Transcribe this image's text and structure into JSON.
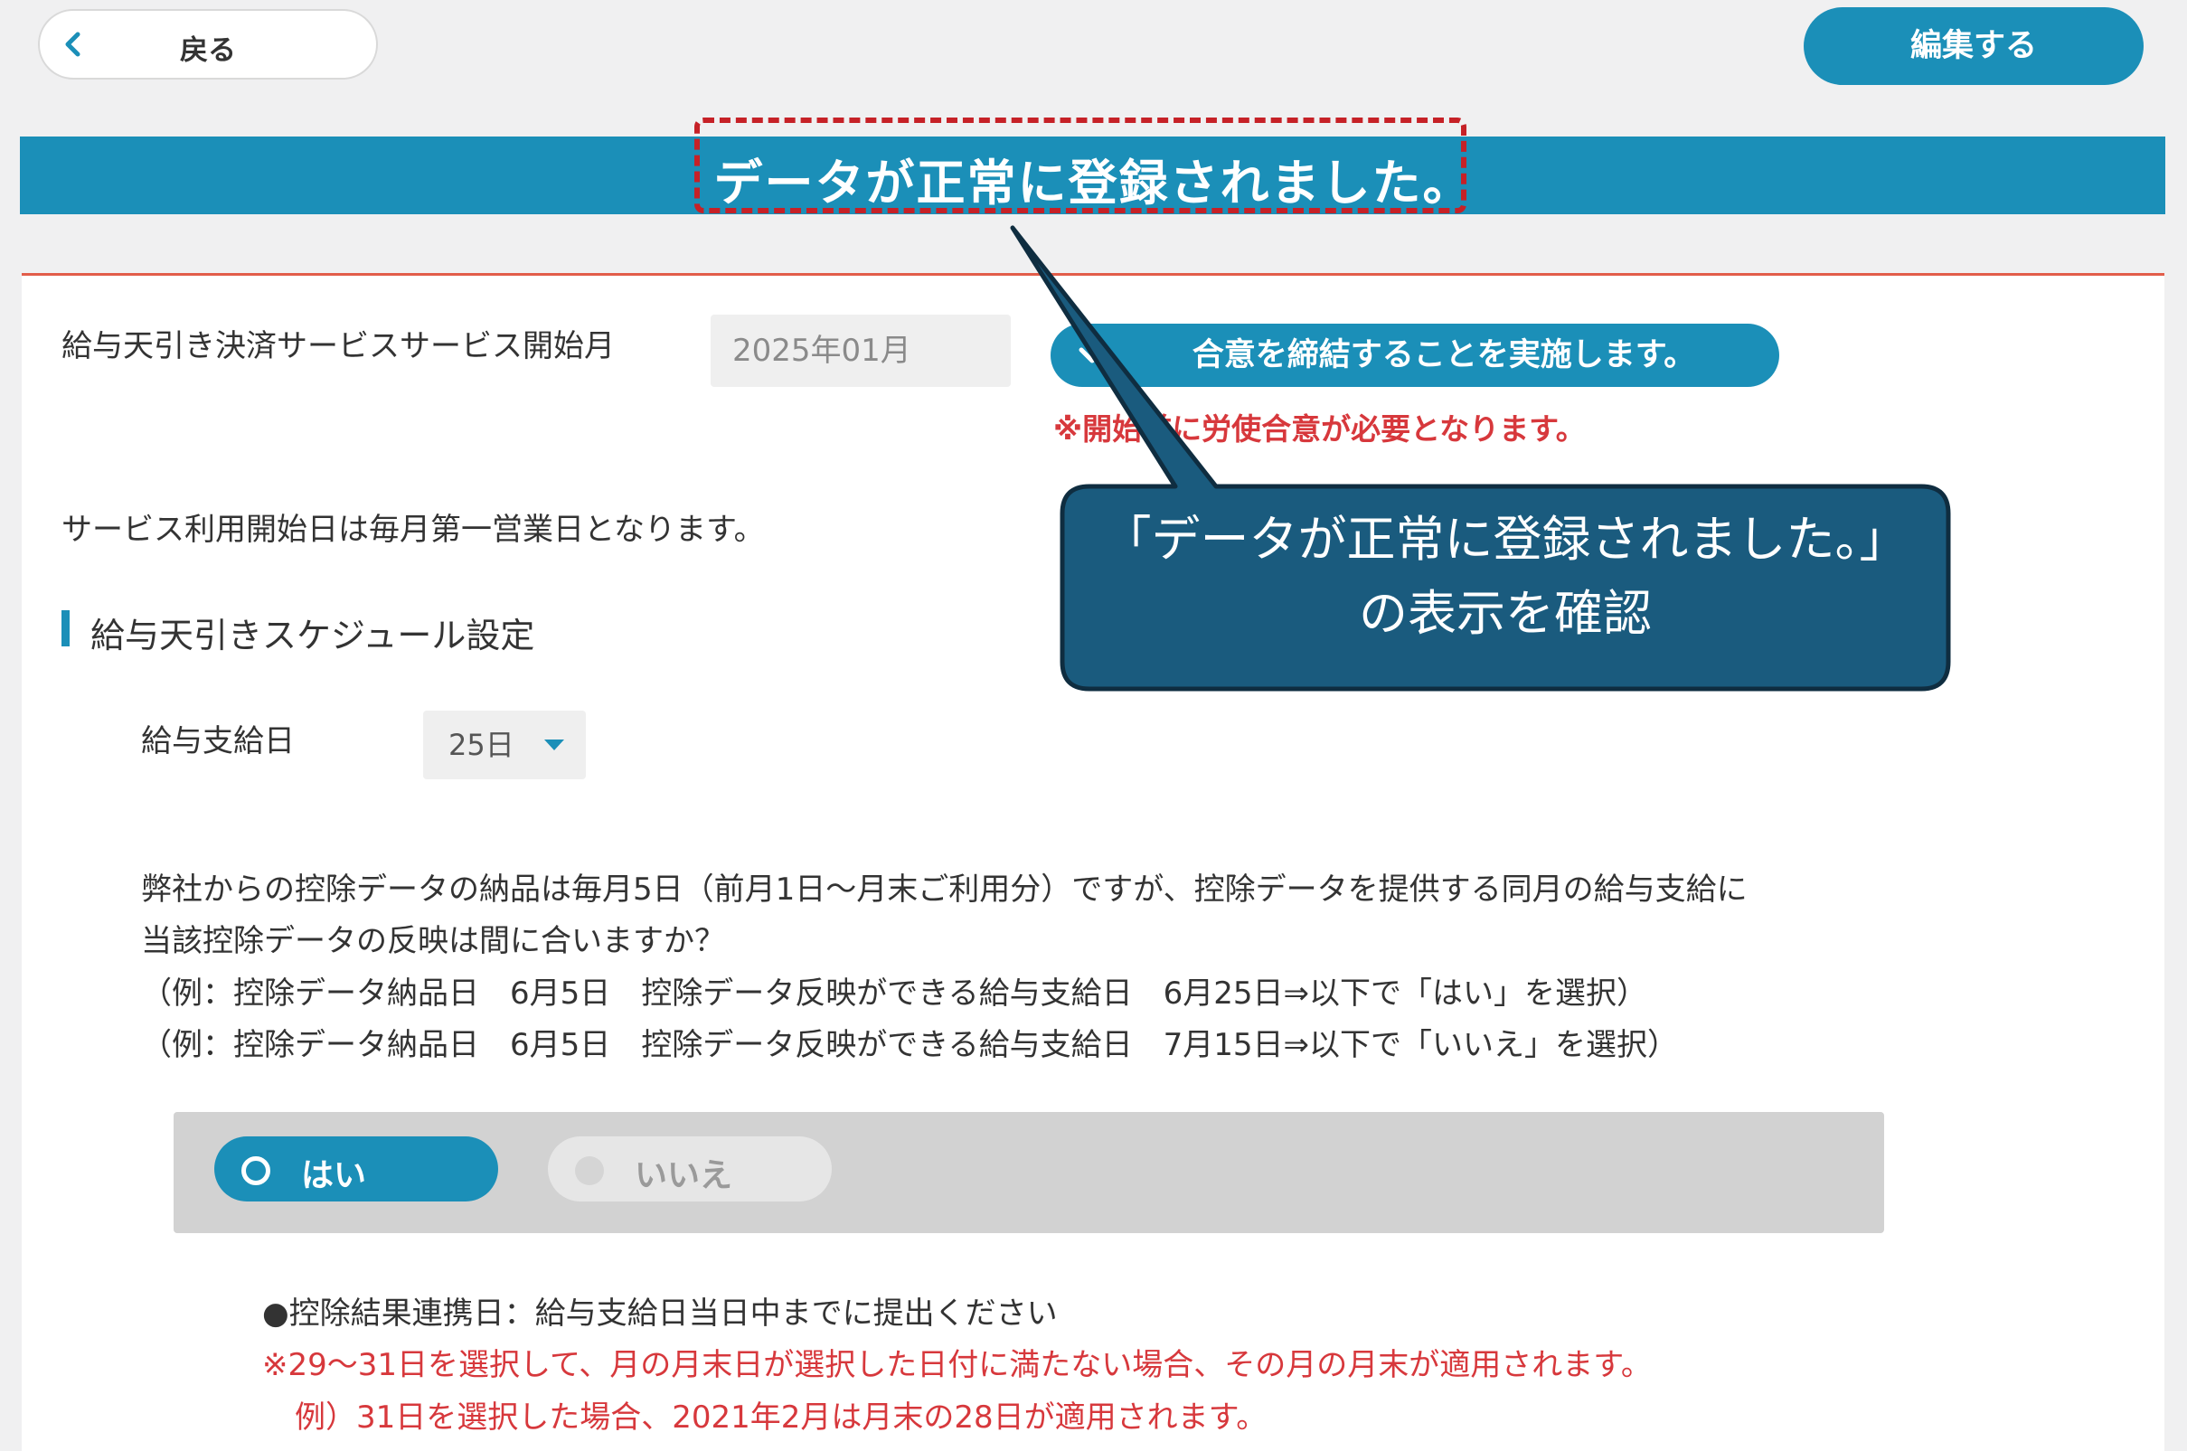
{
  "topbar": {
    "back_label": "戻る",
    "edit_label": "編集する"
  },
  "banner": {
    "message": "データが正常に登録されました。"
  },
  "form": {
    "start_month_label": "給与天引き決済サービスサービス開始月",
    "start_month_value": "2025年01月",
    "agree_button": "合意を締結することを実施します。",
    "agree_note": "※開始前に労使合意が必要となります。",
    "service_note": "サービス利用開始日は毎月第一営業日となります。",
    "section_title": "給与天引きスケジュール設定",
    "payday_label": "給与支給日",
    "payday_value": "25日",
    "question": [
      "弊社からの控除データの納品は毎月5日（前月1日～月末ご利用分）ですが、控除データを提供する同月の給与支給に",
      "当該控除データの反映は間に合いますか？",
      "（例：控除データ納品日　6月5日　控除データ反映ができる給与支給日　6月25日⇒以下で「はい」を選択）",
      "（例：控除データ納品日　6月5日　控除データ反映ができる給与支給日　7月15日⇒以下で「いいえ」を選択）"
    ],
    "radio_yes": "はい",
    "radio_no": "いいえ",
    "selected": "はい",
    "deadline_note": "●控除結果連携日：給与支給日当日中までに提出ください",
    "warning_1": "※29～31日を選択して、月の月末日が選択した日付に満たない場合、その月の月末が適用されます。",
    "warning_2": "例）31日を選択した場合、2021年2月は月末の28日が適用されます。"
  },
  "callout": {
    "line1": "「データが正常に登録されました。」",
    "line2": "の表示を確認"
  },
  "colors": {
    "primary": "#1b8fb8",
    "callout": "#1a5b7e",
    "highlight_outline": "#c62127",
    "warning_text": "#d7383c"
  }
}
